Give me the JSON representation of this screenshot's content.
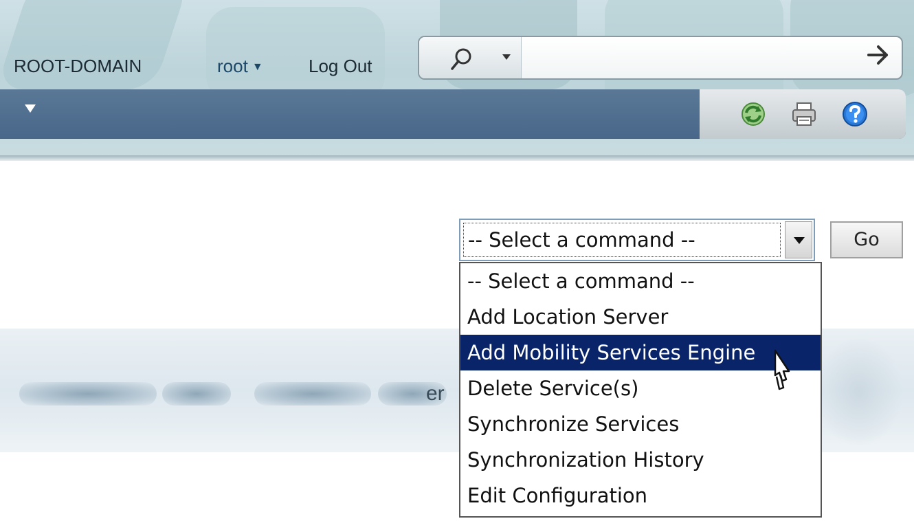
{
  "header": {
    "domain": "ROOT-DOMAIN",
    "user": "root",
    "user_caret": "▼",
    "logout": "Log Out",
    "search": {
      "icon": "search-icon",
      "scope_icon": "chevron-down-icon",
      "go_icon": "arrow-right-icon",
      "value": ""
    }
  },
  "navbar": {
    "menu_icon": "menu-caret-icon",
    "tools": [
      "refresh-icon",
      "print-icon",
      "help-icon"
    ]
  },
  "command": {
    "selected": "-- Select a command --",
    "go_label": "Go",
    "options": [
      "-- Select a command --",
      "Add Location Server",
      "Add Mobility Services Engine",
      "Delete Service(s)",
      "Synchronize Services",
      "Synchronization History",
      "Edit Configuration"
    ],
    "highlighted_index": 2
  },
  "background": {
    "partial_text": "er"
  },
  "colors": {
    "navbar": "#48678a",
    "highlight": "#0a246a",
    "header": "#bcd4da"
  }
}
